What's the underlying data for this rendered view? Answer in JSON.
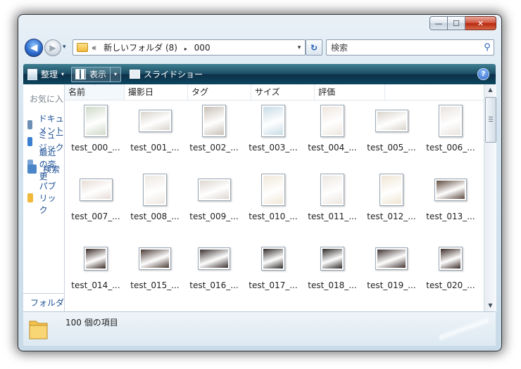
{
  "window": {
    "min_glyph": "—",
    "max_glyph": "☐",
    "close_glyph": "✕"
  },
  "address_bar": {
    "chevron": "«",
    "path_folder": "新しいフォルダ (8)",
    "separator": "▸",
    "path_current": "000",
    "dropdown_glyph": "▾"
  },
  "nav_buttons": {
    "back_glyph": "◀",
    "forward_glyph": "▶",
    "history_glyph": "▾",
    "refresh_glyph": "↻"
  },
  "search": {
    "placeholder": "検索",
    "icon_glyph": "⚲"
  },
  "toolbar": {
    "organize_label": "整理",
    "views_label": "表示",
    "slideshow_label": "スライドショー",
    "caret": "▾",
    "help_glyph": "?"
  },
  "nav_pane": {
    "favorites_title": "お気に入りリンク",
    "items": [
      {
        "label": "ドキュメント",
        "icon": "document-icon",
        "color": "#6e8fb5"
      },
      {
        "label": "ミュージック",
        "icon": "music-icon",
        "color": "#3b7fd1"
      },
      {
        "label": "最近の変更",
        "icon": "recent-icon",
        "color": "#7aa4d6"
      },
      {
        "label": "検索",
        "icon": "search-folder-icon",
        "color": "#4b86c9"
      },
      {
        "label": "パブリック",
        "icon": "folder-icon",
        "color": "#f0b93a"
      }
    ],
    "folders_label": "フォルダ"
  },
  "columns": {
    "sort_glyph": "ˆ",
    "headers": [
      "名前",
      "撮影日",
      "タグ",
      "サイズ",
      "評価"
    ]
  },
  "files": [
    {
      "name": "test_000_...",
      "shape": "portrait",
      "tone": "#cfd9c8"
    },
    {
      "name": "test_001_...",
      "shape": "land",
      "tone": "#d9d4cc"
    },
    {
      "name": "test_002_...",
      "shape": "portrait",
      "tone": "#c9c1b8"
    },
    {
      "name": "test_003_...",
      "shape": "portrait",
      "tone": "#c8dbe6"
    },
    {
      "name": "test_004_...",
      "shape": "portrait",
      "tone": "#eee6de"
    },
    {
      "name": "test_005_...",
      "shape": "land",
      "tone": "#d9d4cc"
    },
    {
      "name": "test_006_...",
      "shape": "portrait",
      "tone": "#e8e3de"
    },
    {
      "name": "test_007_...",
      "shape": "land",
      "tone": "#e6dcd6"
    },
    {
      "name": "test_008_...",
      "shape": "portrait",
      "tone": "#ede7e1"
    },
    {
      "name": "test_009_...",
      "shape": "land",
      "tone": "#dcd6cf"
    },
    {
      "name": "test_010_...",
      "shape": "portrait",
      "tone": "#f0e7d8"
    },
    {
      "name": "test_011_...",
      "shape": "portrait",
      "tone": "#ece6e0"
    },
    {
      "name": "test_012_...",
      "shape": "portrait",
      "tone": "#efe6d4"
    },
    {
      "name": "test_013_...",
      "shape": "wide",
      "tone": "#5e4a3e"
    },
    {
      "name": "test_014_...",
      "shape": "sq",
      "tone": "#3b2c26"
    },
    {
      "name": "test_015_...",
      "shape": "wide",
      "tone": "#4a3a33"
    },
    {
      "name": "test_016_...",
      "shape": "wide",
      "tone": "#3a3230"
    },
    {
      "name": "test_017_...",
      "shape": "sq",
      "tone": "#2e2a28"
    },
    {
      "name": "test_018_...",
      "shape": "sq",
      "tone": "#2c2826"
    },
    {
      "name": "test_019_...",
      "shape": "wide",
      "tone": "#3f3431"
    },
    {
      "name": "test_020_...",
      "shape": "sq",
      "tone": "#3a2b26"
    }
  ],
  "status": {
    "item_count": "100 個の項目"
  },
  "scrollbar": {
    "up_glyph": "▲",
    "down_glyph": "▼"
  }
}
